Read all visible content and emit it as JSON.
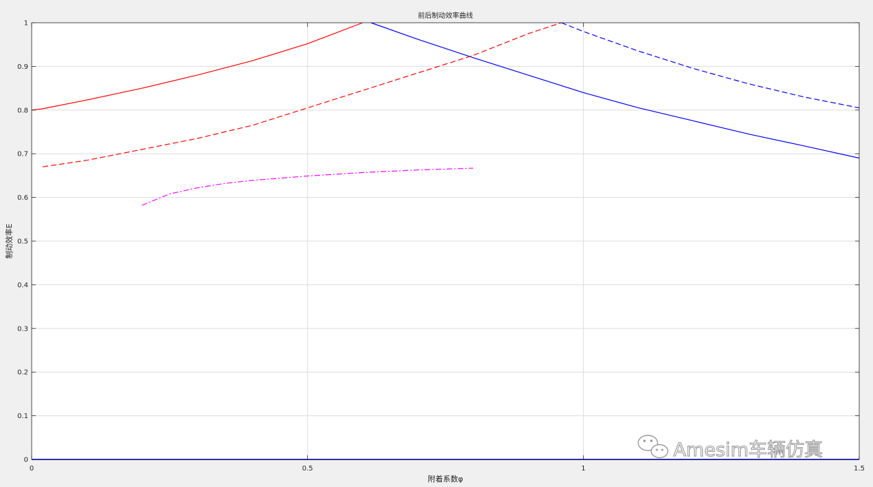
{
  "chart_data": {
    "type": "line",
    "title": "前后制动效率曲线",
    "xlabel": "附着系数φ",
    "ylabel": "制动效率E",
    "xlim": [
      0,
      1.5
    ],
    "ylim": [
      0,
      1
    ],
    "xticks": [
      "0",
      "0.5",
      "1",
      "1.5"
    ],
    "yticks": [
      "0",
      "0.1",
      "0.2",
      "0.3",
      "0.4",
      "0.5",
      "0.6",
      "0.7",
      "0.8",
      "0.9",
      "1"
    ],
    "grid": true,
    "series": [
      {
        "style": "solid",
        "color": "#ff0000",
        "x": [
          0,
          0.02,
          0.1,
          0.2,
          0.3,
          0.4,
          0.5,
          0.6
        ],
        "y": [
          0.8,
          0.803,
          0.823,
          0.85,
          0.88,
          0.913,
          0.952,
          1.0
        ]
      },
      {
        "style": "solid",
        "color": "#0000ff",
        "x": [
          0.615,
          0.7,
          0.8,
          0.9,
          1.0,
          1.1,
          1.2,
          1.3,
          1.4,
          1.5
        ],
        "y": [
          1.0,
          0.962,
          0.92,
          0.88,
          0.84,
          0.805,
          0.775,
          0.745,
          0.718,
          0.69
        ]
      },
      {
        "style": "dashed",
        "color": "#ff0000",
        "x": [
          0.02,
          0.1,
          0.2,
          0.3,
          0.4,
          0.5,
          0.6,
          0.7,
          0.8,
          0.9,
          0.96
        ],
        "y": [
          0.67,
          0.685,
          0.71,
          0.735,
          0.765,
          0.805,
          0.845,
          0.885,
          0.925,
          0.975,
          1.0
        ]
      },
      {
        "style": "dashed",
        "color": "#0000ff",
        "x": [
          0.96,
          1.0,
          1.1,
          1.2,
          1.3,
          1.4,
          1.5
        ],
        "y": [
          1.0,
          0.98,
          0.935,
          0.895,
          0.86,
          0.83,
          0.805
        ]
      },
      {
        "style": "dashdot",
        "color": "#ff00ff",
        "x": [
          0.2,
          0.25,
          0.3,
          0.35,
          0.4,
          0.45,
          0.5,
          0.55,
          0.6,
          0.65,
          0.7,
          0.75,
          0.8
        ],
        "y": [
          0.582,
          0.608,
          0.622,
          0.632,
          0.639,
          0.644,
          0.649,
          0.653,
          0.657,
          0.66,
          0.663,
          0.665,
          0.667
        ]
      },
      {
        "style": "solid",
        "color": "#0000ff",
        "x": [
          0,
          1.5
        ],
        "y": [
          0,
          0
        ]
      }
    ]
  },
  "watermark": {
    "text": "Amesim车辆仿真",
    "icon": "wechat-icon"
  }
}
